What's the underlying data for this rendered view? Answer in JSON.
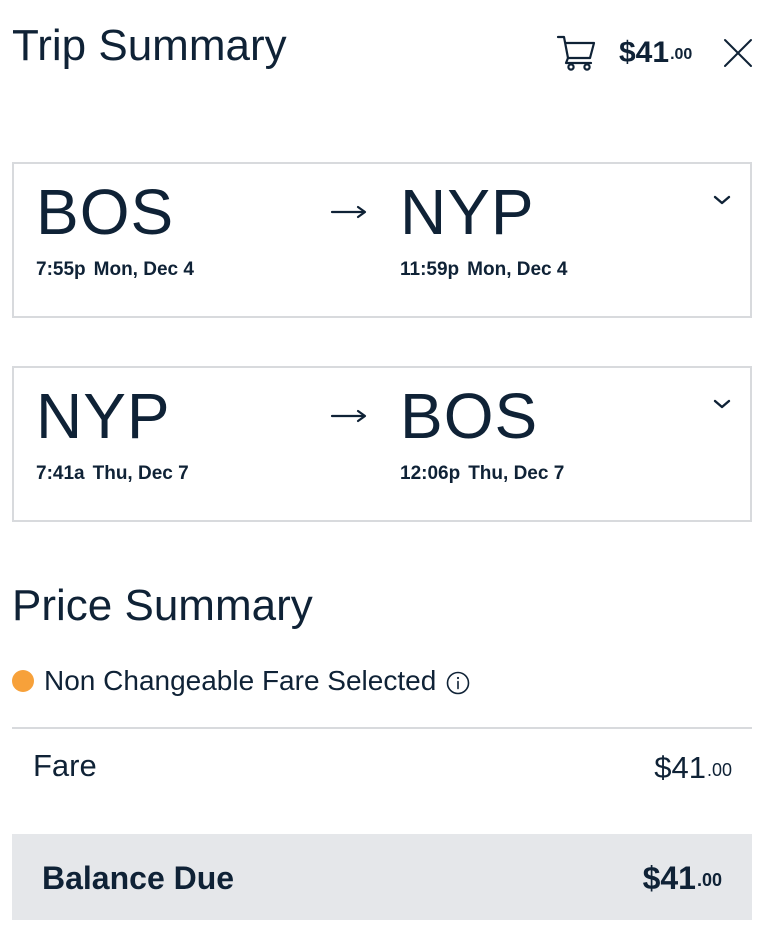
{
  "header": {
    "title": "Trip Summary",
    "cart_icon": "cart-icon",
    "cart_total_dollars": "$41",
    "cart_total_cents": ".00",
    "close_icon": "close-icon"
  },
  "legs": [
    {
      "origin": "BOS",
      "destination": "NYP",
      "depart_time": "7:55p",
      "depart_date": "Mon, Dec 4",
      "arrive_time": "11:59p",
      "arrive_date": "Mon, Dec 4",
      "arrow_icon": "arrow-right-icon",
      "expand_icon": "chevron-down-icon"
    },
    {
      "origin": "NYP",
      "destination": "BOS",
      "depart_time": "7:41a",
      "depart_date": "Thu, Dec 7",
      "arrive_time": "12:06p",
      "arrive_date": "Thu, Dec 7",
      "arrow_icon": "arrow-right-icon",
      "expand_icon": "chevron-down-icon"
    }
  ],
  "price_summary": {
    "title": "Price Summary",
    "fare_notice": "Non Changeable Fare Selected",
    "fare_notice_dot_color": "#f7a13a",
    "info_icon": "info-icon",
    "fare_label": "Fare",
    "fare_dollars": "$41",
    "fare_cents": ".00",
    "balance_label": "Balance Due",
    "balance_dollars": "$41",
    "balance_cents": ".00"
  },
  "colors": {
    "text": "#0f2236",
    "border": "#d8dadd",
    "balance_bg": "#e5e7ea",
    "accent_dot": "#f7a13a"
  }
}
